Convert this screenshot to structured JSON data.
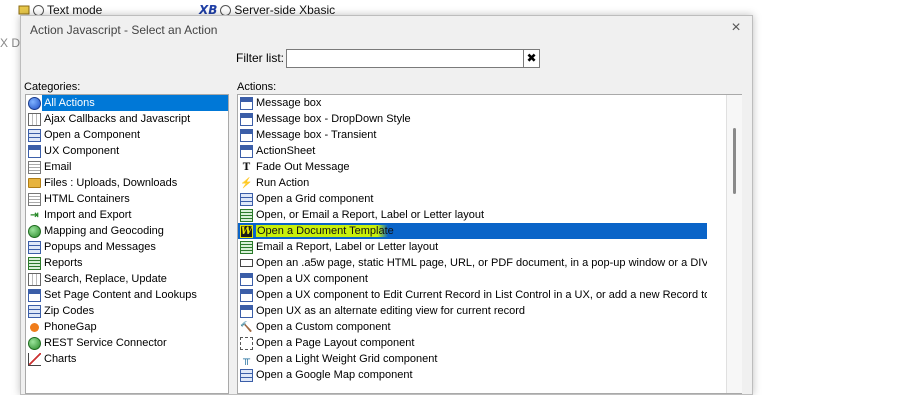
{
  "background": {
    "radio_text_mode": "Text mode",
    "radio_server_xbasic": "Server-side Xbasic",
    "xb_logo": "XB",
    "left_glyph": "X D"
  },
  "dialog": {
    "title": "Action Javascript - Select an Action",
    "close_label": "×",
    "filter_label": "Filter list:",
    "filter_value": "",
    "filter_clear_label": "✖",
    "categories_label": "Categories:",
    "actions_label": "Actions:"
  },
  "categories": [
    {
      "label": "All Actions",
      "icon": "globe-icon",
      "selected": true
    },
    {
      "label": "Ajax Callbacks and Javascript",
      "icon": "ajax-icon"
    },
    {
      "label": "Open a Component",
      "icon": "grid-icon"
    },
    {
      "label": "UX Component",
      "icon": "window-icon"
    },
    {
      "label": "Email",
      "icon": "email-icon"
    },
    {
      "label": "Files : Uploads, Downloads",
      "icon": "folder-icon"
    },
    {
      "label": "HTML Containers",
      "icon": "document-icon"
    },
    {
      "label": "Import and Export",
      "icon": "import-icon"
    },
    {
      "label": "Mapping and Geocoding",
      "icon": "map-globe-icon"
    },
    {
      "label": "Popups and Messages",
      "icon": "popup-icon"
    },
    {
      "label": "Reports",
      "icon": "report-icon"
    },
    {
      "label": "Search, Replace, Update",
      "icon": "search-replace-icon"
    },
    {
      "label": "Set Page Content and Lookups",
      "icon": "page-content-icon"
    },
    {
      "label": "Zip Codes",
      "icon": "zip-icon"
    },
    {
      "label": "PhoneGap",
      "icon": "phonegap-icon"
    },
    {
      "label": "REST Service Connector",
      "icon": "rest-globe-icon"
    },
    {
      "label": "Charts",
      "icon": "chart-icon"
    }
  ],
  "actions": [
    {
      "label": "Message box",
      "icon": "message-box-icon"
    },
    {
      "label": "Message box - DropDown Style",
      "icon": "message-box-icon"
    },
    {
      "label": "Message box - Transient",
      "icon": "message-box-icon"
    },
    {
      "label": "ActionSheet",
      "icon": "message-box-icon"
    },
    {
      "label": "Fade Out Message",
      "icon": "text-icon"
    },
    {
      "label": "Run Action",
      "icon": "lightning-icon"
    },
    {
      "label": "Open a Grid component",
      "icon": "grid-icon"
    },
    {
      "label": "Open, or Email a Report, Label or Letter layout",
      "icon": "report-icon"
    },
    {
      "label": "Open a Document Template",
      "icon": "word-template-icon",
      "selected": true
    },
    {
      "label": "Email a Report, Label or Letter layout",
      "icon": "report-icon"
    },
    {
      "label": "Open an .a5w page, static HTML page, URL, or PDF document, in a pop-up window or a DIV",
      "icon": "page-icon"
    },
    {
      "label": "Open a UX component",
      "icon": "window-icon"
    },
    {
      "label": "Open a UX component to Edit Current Record in List Control in a UX, or add a new Record to a List",
      "icon": "window-icon"
    },
    {
      "label": "Open UX as an alternate editing view for current record",
      "icon": "window-icon"
    },
    {
      "label": "Open a Custom component",
      "icon": "tool-icon"
    },
    {
      "label": "Open a Page Layout component",
      "icon": "page-layout-icon"
    },
    {
      "label": "Open a Light Weight Grid component",
      "icon": "lightweight-grid-icon"
    },
    {
      "label": "Open a Google Map component",
      "icon": "map-icon"
    }
  ]
}
